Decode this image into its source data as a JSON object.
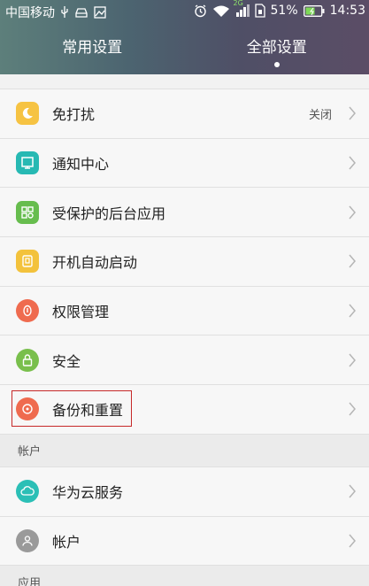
{
  "status_bar": {
    "carrier": "中国移动",
    "network": "2G",
    "battery": "51%",
    "time": "14:53"
  },
  "tabs": [
    {
      "label": "常用设置",
      "active": false
    },
    {
      "label": "全部设置",
      "active": true
    }
  ],
  "items": [
    {
      "label": "免打扰",
      "value": "关闭",
      "icon": "moon-icon",
      "color": "#f6c343"
    },
    {
      "label": "通知中心",
      "value": "",
      "icon": "notification-icon",
      "color": "#27b9b3"
    },
    {
      "label": "受保护的后台应用",
      "value": "",
      "icon": "protected-apps-icon",
      "color": "#67bd4e"
    },
    {
      "label": "开机自动启动",
      "value": "",
      "icon": "startup-icon",
      "color": "#f3c23c"
    },
    {
      "label": "权限管理",
      "value": "",
      "icon": "permission-icon",
      "color": "#ef6b4f"
    },
    {
      "label": "安全",
      "value": "",
      "icon": "lock-icon",
      "color": "#79bf4c"
    },
    {
      "label": "备份和重置",
      "value": "",
      "icon": "backup-icon",
      "color": "#ef6b4f"
    }
  ],
  "sections": {
    "account": "帐户",
    "apps": "应用"
  },
  "account_items": [
    {
      "label": "华为云服务",
      "icon": "cloud-icon",
      "color": "#2bbfb6"
    },
    {
      "label": "帐户",
      "icon": "user-icon",
      "color": "#9a9a9a"
    }
  ]
}
